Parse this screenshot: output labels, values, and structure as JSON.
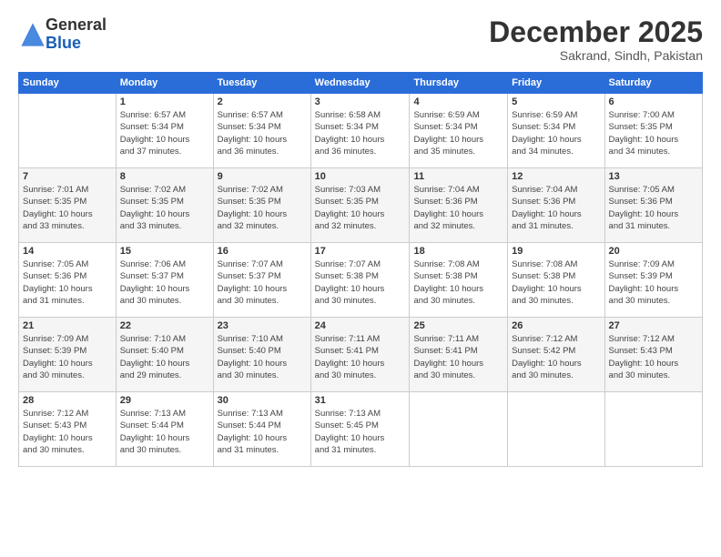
{
  "logo": {
    "line1": "General",
    "line2": "Blue"
  },
  "title": "December 2025",
  "location": "Sakrand, Sindh, Pakistan",
  "weekdays": [
    "Sunday",
    "Monday",
    "Tuesday",
    "Wednesday",
    "Thursday",
    "Friday",
    "Saturday"
  ],
  "weeks": [
    [
      {
        "day": "",
        "info": ""
      },
      {
        "day": "1",
        "info": "Sunrise: 6:57 AM\nSunset: 5:34 PM\nDaylight: 10 hours\nand 37 minutes."
      },
      {
        "day": "2",
        "info": "Sunrise: 6:57 AM\nSunset: 5:34 PM\nDaylight: 10 hours\nand 36 minutes."
      },
      {
        "day": "3",
        "info": "Sunrise: 6:58 AM\nSunset: 5:34 PM\nDaylight: 10 hours\nand 36 minutes."
      },
      {
        "day": "4",
        "info": "Sunrise: 6:59 AM\nSunset: 5:34 PM\nDaylight: 10 hours\nand 35 minutes."
      },
      {
        "day": "5",
        "info": "Sunrise: 6:59 AM\nSunset: 5:34 PM\nDaylight: 10 hours\nand 34 minutes."
      },
      {
        "day": "6",
        "info": "Sunrise: 7:00 AM\nSunset: 5:35 PM\nDaylight: 10 hours\nand 34 minutes."
      }
    ],
    [
      {
        "day": "7",
        "info": "Sunrise: 7:01 AM\nSunset: 5:35 PM\nDaylight: 10 hours\nand 33 minutes."
      },
      {
        "day": "8",
        "info": "Sunrise: 7:02 AM\nSunset: 5:35 PM\nDaylight: 10 hours\nand 33 minutes."
      },
      {
        "day": "9",
        "info": "Sunrise: 7:02 AM\nSunset: 5:35 PM\nDaylight: 10 hours\nand 32 minutes."
      },
      {
        "day": "10",
        "info": "Sunrise: 7:03 AM\nSunset: 5:35 PM\nDaylight: 10 hours\nand 32 minutes."
      },
      {
        "day": "11",
        "info": "Sunrise: 7:04 AM\nSunset: 5:36 PM\nDaylight: 10 hours\nand 32 minutes."
      },
      {
        "day": "12",
        "info": "Sunrise: 7:04 AM\nSunset: 5:36 PM\nDaylight: 10 hours\nand 31 minutes."
      },
      {
        "day": "13",
        "info": "Sunrise: 7:05 AM\nSunset: 5:36 PM\nDaylight: 10 hours\nand 31 minutes."
      }
    ],
    [
      {
        "day": "14",
        "info": "Sunrise: 7:05 AM\nSunset: 5:36 PM\nDaylight: 10 hours\nand 31 minutes."
      },
      {
        "day": "15",
        "info": "Sunrise: 7:06 AM\nSunset: 5:37 PM\nDaylight: 10 hours\nand 30 minutes."
      },
      {
        "day": "16",
        "info": "Sunrise: 7:07 AM\nSunset: 5:37 PM\nDaylight: 10 hours\nand 30 minutes."
      },
      {
        "day": "17",
        "info": "Sunrise: 7:07 AM\nSunset: 5:38 PM\nDaylight: 10 hours\nand 30 minutes."
      },
      {
        "day": "18",
        "info": "Sunrise: 7:08 AM\nSunset: 5:38 PM\nDaylight: 10 hours\nand 30 minutes."
      },
      {
        "day": "19",
        "info": "Sunrise: 7:08 AM\nSunset: 5:38 PM\nDaylight: 10 hours\nand 30 minutes."
      },
      {
        "day": "20",
        "info": "Sunrise: 7:09 AM\nSunset: 5:39 PM\nDaylight: 10 hours\nand 30 minutes."
      }
    ],
    [
      {
        "day": "21",
        "info": "Sunrise: 7:09 AM\nSunset: 5:39 PM\nDaylight: 10 hours\nand 30 minutes."
      },
      {
        "day": "22",
        "info": "Sunrise: 7:10 AM\nSunset: 5:40 PM\nDaylight: 10 hours\nand 29 minutes."
      },
      {
        "day": "23",
        "info": "Sunrise: 7:10 AM\nSunset: 5:40 PM\nDaylight: 10 hours\nand 30 minutes."
      },
      {
        "day": "24",
        "info": "Sunrise: 7:11 AM\nSunset: 5:41 PM\nDaylight: 10 hours\nand 30 minutes."
      },
      {
        "day": "25",
        "info": "Sunrise: 7:11 AM\nSunset: 5:41 PM\nDaylight: 10 hours\nand 30 minutes."
      },
      {
        "day": "26",
        "info": "Sunrise: 7:12 AM\nSunset: 5:42 PM\nDaylight: 10 hours\nand 30 minutes."
      },
      {
        "day": "27",
        "info": "Sunrise: 7:12 AM\nSunset: 5:43 PM\nDaylight: 10 hours\nand 30 minutes."
      }
    ],
    [
      {
        "day": "28",
        "info": "Sunrise: 7:12 AM\nSunset: 5:43 PM\nDaylight: 10 hours\nand 30 minutes."
      },
      {
        "day": "29",
        "info": "Sunrise: 7:13 AM\nSunset: 5:44 PM\nDaylight: 10 hours\nand 30 minutes."
      },
      {
        "day": "30",
        "info": "Sunrise: 7:13 AM\nSunset: 5:44 PM\nDaylight: 10 hours\nand 31 minutes."
      },
      {
        "day": "31",
        "info": "Sunrise: 7:13 AM\nSunset: 5:45 PM\nDaylight: 10 hours\nand 31 minutes."
      },
      {
        "day": "",
        "info": ""
      },
      {
        "day": "",
        "info": ""
      },
      {
        "day": "",
        "info": ""
      }
    ]
  ]
}
